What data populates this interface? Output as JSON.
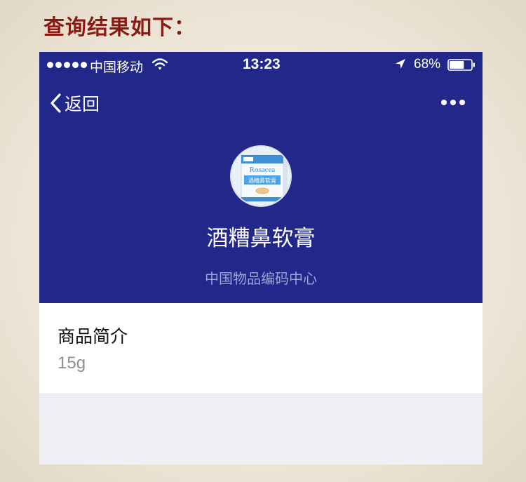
{
  "page": {
    "heading": "查询结果如下："
  },
  "status_bar": {
    "carrier": "中国移动",
    "time": "13:23",
    "battery": "68%",
    "battery_level": 0.68
  },
  "nav": {
    "back_label": "返回"
  },
  "product": {
    "name": "酒糟鼻软膏",
    "publisher": "中国物品编码中心",
    "image_texts": {
      "brand": "Rosacea",
      "name": "酒糟鼻软膏"
    }
  },
  "details": {
    "title": "商品简介",
    "value": "15g"
  },
  "colors": {
    "heading": "#8b1a12",
    "hero_bg": "#22278a",
    "publisher_text": "#9fa4d6",
    "page_bg": "#efeff4"
  }
}
